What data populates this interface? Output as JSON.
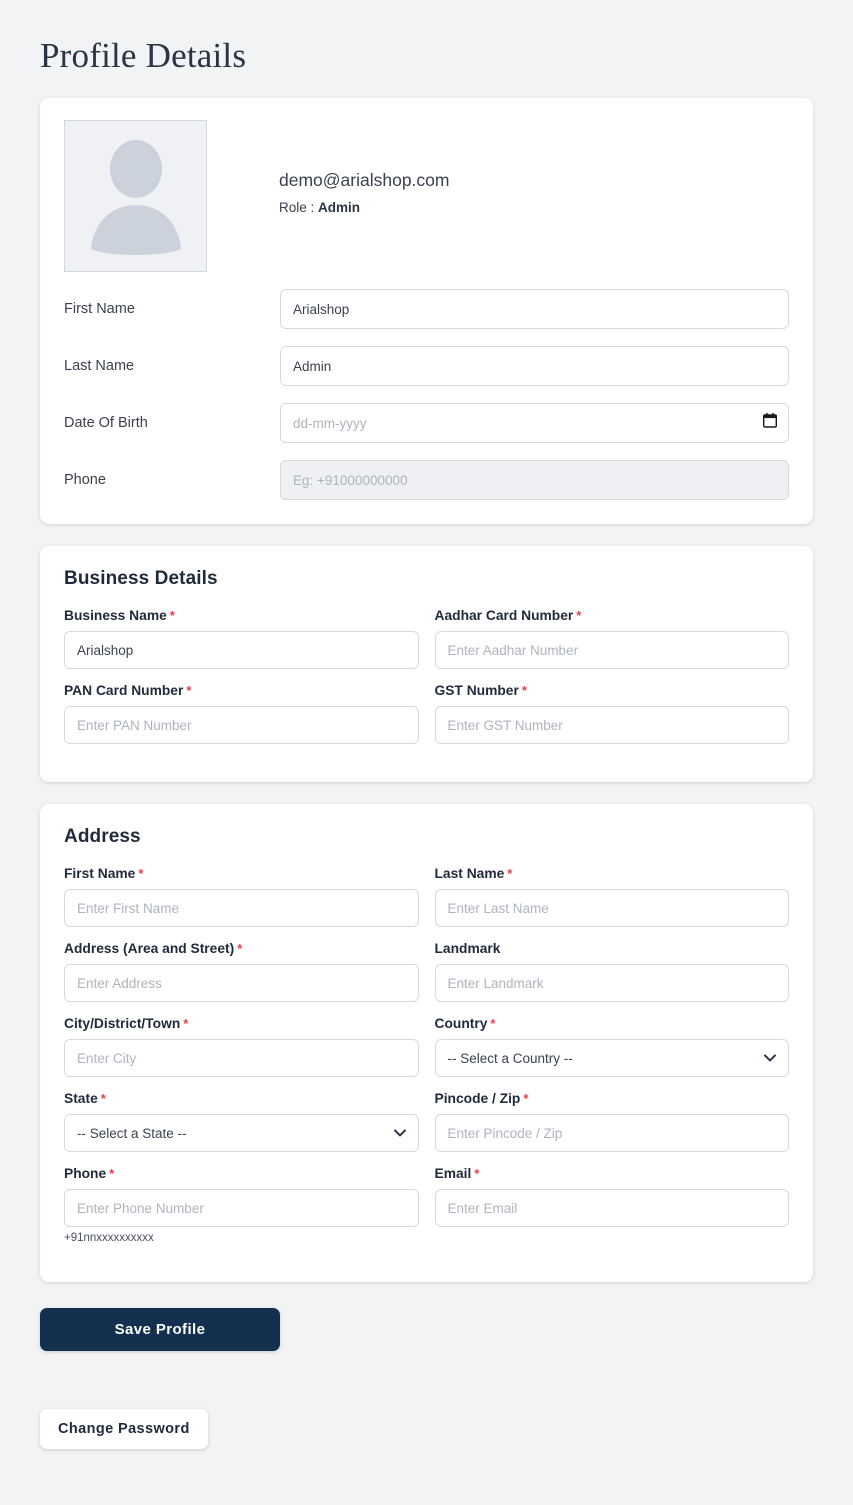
{
  "page": {
    "title": "Profile Details",
    "background_color": "#f1f3f5"
  },
  "profile": {
    "avatar_icon": "user-placeholder-icon",
    "email": "demo@arialshop.com",
    "role_label": "Role :",
    "role_value": "Admin",
    "fields": [
      {
        "label": "First Name",
        "value": "Arialshop",
        "placeholder": "",
        "type": "text",
        "disabled": false
      },
      {
        "label": "Last Name",
        "value": "Admin",
        "placeholder": "",
        "type": "text",
        "disabled": false
      },
      {
        "label": "Date Of Birth",
        "value": "",
        "placeholder": "dd-mm-yyyy",
        "type": "date",
        "disabled": false
      },
      {
        "label": "Phone",
        "value": "",
        "placeholder": "Eg: +91000000000",
        "type": "text",
        "disabled": true
      }
    ]
  },
  "business": {
    "title": "Business Details",
    "fields": [
      {
        "label": "Business Name",
        "required": true,
        "value": "Arialshop",
        "placeholder": ""
      },
      {
        "label": "Aadhar Card Number",
        "required": true,
        "value": "",
        "placeholder": "Enter Aadhar Number"
      },
      {
        "label": "PAN Card Number",
        "required": true,
        "value": "",
        "placeholder": "Enter PAN Number"
      },
      {
        "label": "GST Number",
        "required": true,
        "value": "",
        "placeholder": "Enter GST Number"
      }
    ]
  },
  "address": {
    "title": "Address",
    "fields": [
      {
        "label": "First Name",
        "required": true,
        "kind": "input",
        "value": "",
        "placeholder": "Enter First Name"
      },
      {
        "label": "Last Name",
        "required": true,
        "kind": "input",
        "value": "",
        "placeholder": "Enter Last Name"
      },
      {
        "label": "Address (Area and Street)",
        "required": true,
        "kind": "input",
        "value": "",
        "placeholder": "Enter Address"
      },
      {
        "label": "Landmark",
        "required": false,
        "kind": "input",
        "value": "",
        "placeholder": "Enter Landmark"
      },
      {
        "label": "City/District/Town",
        "required": true,
        "kind": "input",
        "value": "",
        "placeholder": "Enter City"
      },
      {
        "label": "Country",
        "required": true,
        "kind": "select",
        "value": "-- Select a Country --",
        "placeholder": ""
      },
      {
        "label": "State",
        "required": true,
        "kind": "select",
        "value": "-- Select a State --",
        "placeholder": ""
      },
      {
        "label": "Pincode / Zip",
        "required": true,
        "kind": "input",
        "value": "",
        "placeholder": "Enter Pincode / Zip"
      },
      {
        "label": "Phone",
        "required": true,
        "kind": "input",
        "value": "",
        "placeholder": "Enter Phone Number",
        "hint": "+91nnxxxxxxxxxx"
      },
      {
        "label": "Email",
        "required": true,
        "kind": "input",
        "value": "",
        "placeholder": "Enter Email"
      }
    ]
  },
  "actions": {
    "save_label": "Save Profile",
    "change_password_label": "Change Password"
  },
  "colors": {
    "accent": "#14304f",
    "required_asterisk": "#e8404a",
    "heading": "#1f2a3a",
    "page_bg": "#f1f3f5",
    "card_bg": "#ffffff",
    "input_border": "#d6dae0",
    "disabled_bg": "#eef0f3",
    "avatar_bg": "#eff1f4",
    "avatar_fill": "#ccd2dc"
  },
  "icons": {
    "calendar": "calendar-icon",
    "chevron_down": "chevron-down-icon",
    "user_placeholder": "user-placeholder-icon"
  }
}
